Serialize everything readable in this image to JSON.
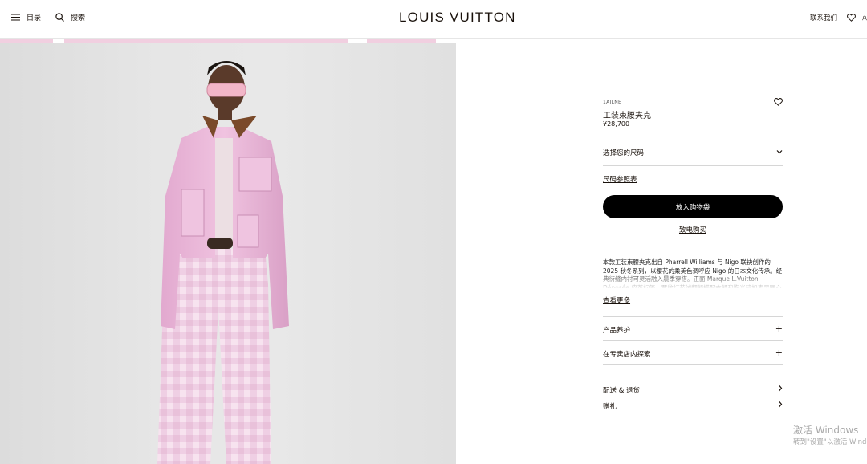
{
  "header": {
    "menu_label": "目录",
    "search_label": "搜索",
    "logo": "LOUIS VUITTON",
    "contact_label": "联系我们"
  },
  "product": {
    "sku": "1AILNE",
    "name": "工装束腰夹克",
    "price": "¥28,700",
    "size_select_label": "选择您的尺码",
    "size_chart_label": "尺码参照表",
    "add_to_bag_label": "放入购物袋",
    "call_to_buy_label": "致电购买",
    "description": "本款工装束腰夹克出自 Pharrell Williams 与 Nigo 联袂创作的 2025 秋冬系列，以樱花的柔美色调呼应 Nigo 的日本文化传承。经典衍缝内衬可灵活融入晨季穿搭。正面 Marque L.Vuitton Déposée 皮革标签，罗纹灯芯绒翻领搭配衣领和胸光较扣表显匠心细节。",
    "see_more_label": "查看更多",
    "accordions": [
      {
        "label": "产品养护"
      },
      {
        "label": "在专卖店内探索"
      }
    ],
    "links": [
      {
        "label": "配送 & 退货"
      },
      {
        "label": "赠礼"
      }
    ]
  },
  "watermark": {
    "line1": "激活 Windows",
    "line2": "转到\"设置\"以激活 Windows。"
  },
  "colors": {
    "text": "#19110b",
    "button_bg": "#000000",
    "jacket_pink": "#e6b3d4",
    "divider": "#d6d6d6"
  },
  "icons": [
    "menu-icon",
    "search-icon",
    "heart-icon",
    "user-icon",
    "chevron-down-icon",
    "plus-icon",
    "chevron-right-icon"
  ]
}
